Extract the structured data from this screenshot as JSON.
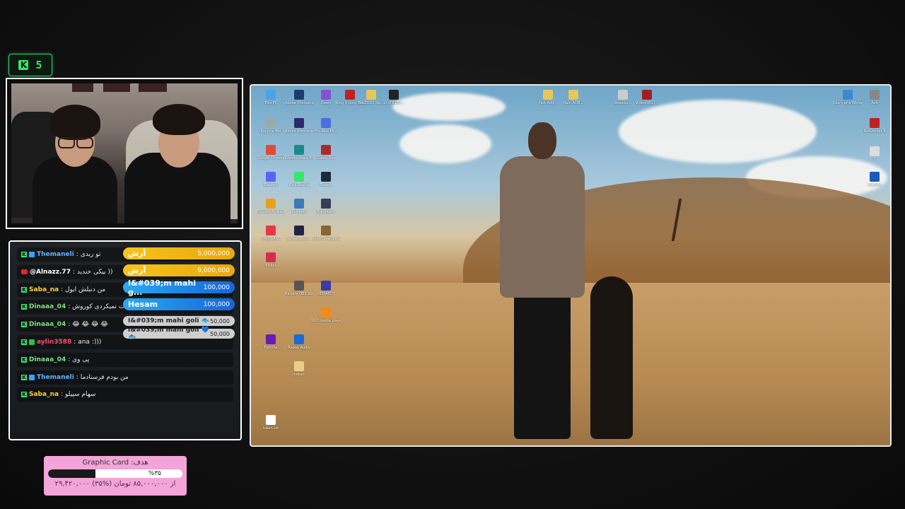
{
  "viewers": {
    "platform_icon": "K",
    "count": "5"
  },
  "chat": [
    {
      "platform": "kick",
      "badge": "blue",
      "user": "Themaneli",
      "user_color": "#5fb6ff",
      "message": ": تو ریدی"
    },
    {
      "platform": "youtube",
      "badge": "",
      "user": "@Alnazz.77",
      "user_color": "#ffffff",
      "message": ": بیکی خندید ))"
    },
    {
      "platform": "kick",
      "badge": "",
      "user": "Saba_na",
      "user_color": "#ffd23f",
      "message": ": من دنبلش ایول"
    },
    {
      "platform": "kick",
      "badge": "",
      "user": "Dinaaa_04",
      "user_color": "#7fe07f",
      "message": ": یا خودت نمیکردی کوروش"
    },
    {
      "platform": "kick",
      "badge": "",
      "user": "Dinaaa_04",
      "user_color": "#7fe07f",
      "message": ": 😂 😂 😂 😂"
    },
    {
      "platform": "kick",
      "badge": "green",
      "user": "aylin3588",
      "user_color": "#ff4d6d",
      "message": ": ana :)))"
    },
    {
      "platform": "kick",
      "badge": "",
      "user": "Dinaaa_04",
      "user_color": "#7fe07f",
      "message": ": پی وی"
    },
    {
      "platform": "kick",
      "badge": "blue",
      "user": "Themaneli",
      "user_color": "#5fb6ff",
      "message": ": من بودم فرستادما"
    },
    {
      "platform": "kick",
      "badge": "",
      "user": "Saba_na",
      "user_color": "#ffd23f",
      "message": ": سهام سپیلو"
    }
  ],
  "donations": [
    {
      "name": "آرش",
      "amount": "5,000,000",
      "style": "gold"
    },
    {
      "name": "آرش",
      "amount": "9,000,000",
      "style": "gold"
    },
    {
      "name": "I&#039;m mahi g...",
      "amount": "100,000",
      "style": "blue"
    },
    {
      "name": "Hesam",
      "amount": "100,000",
      "style": "blue"
    },
    {
      "name": "I&#039;m mahi goli 🐟",
      "amount": "50,000",
      "style": "gray"
    },
    {
      "name": "I&#039;m mahi goli 💙🐟",
      "amount": "50,000",
      "style": "gray"
    }
  ],
  "goal": {
    "title": "Graphic Card :هدف",
    "percent_label": "%۳۵",
    "progress": 0.35,
    "amount": "۲۹,۴۲۰,۰۰۰ از ۸۵,۰۰۰,۰۰۰ تومان (%۳۵)"
  },
  "desktop_icons": [
    {
      "label": "This PC",
      "color": "#4aa3e8"
    },
    {
      "label": "Adobe Photosho...",
      "color": "#1c3c6e"
    },
    {
      "label": "Dawn",
      "color": "#8a4fd0"
    },
    {
      "label": "King 9 Gold Events",
      "color": "#c02020"
    },
    {
      "label": "MAZOO3 No...",
      "color": "#e6c75a"
    },
    {
      "label": "1f 1FE2E8...",
      "color": "#222"
    },
    {
      "label": "Recycle Bin",
      "color": "#9aa"
    },
    {
      "label": "Adobe Premiere Pro",
      "color": "#2a2a6a"
    },
    {
      "label": "Pro Max Plus",
      "color": "#4b6fe0"
    },
    {
      "label": "Google Chrome",
      "color": "#e24a3a"
    },
    {
      "label": "Wondershare Filmora 14",
      "color": "#1a8a8a"
    },
    {
      "label": "Game Bar",
      "color": "#aa2a2a"
    },
    {
      "label": "Discord",
      "color": "#5865f2"
    },
    {
      "label": "Kick Studio",
      "color": "#39e46f"
    },
    {
      "label": "Steam",
      "color": "#1b2838"
    },
    {
      "label": "VALORANT",
      "color": "#e63946"
    },
    {
      "label": "StreamShot...",
      "color": "#222244"
    },
    {
      "label": "Road Crew Simulator",
      "color": "#886633"
    },
    {
      "label": "Kicker",
      "color": "#d82d4a"
    },
    {
      "label": "Counter-Strike 2",
      "color": "#e8a21a"
    },
    {
      "label": "Portfolio",
      "color": "#3a7ab8"
    },
    {
      "label": "Bandicam",
      "color": "#3a3a5a"
    },
    {
      "label": "Battery OBS Streaming",
      "color": "#555"
    },
    {
      "label": "REMATCH",
      "color": "#3a3aa8"
    },
    {
      "label": "VLC media player",
      "color": "#f08c1a"
    },
    {
      "label": "Rapoo Audio",
      "color": "#1a6ad8"
    },
    {
      "label": "Fortnite",
      "color": "#6a1ab8"
    },
    {
      "label": "metam",
      "color": "#e8d08a"
    },
    {
      "label": "token.txt",
      "color": "#ffffff"
    },
    {
      "label": "Fast Add...",
      "color": "#e8c75a"
    },
    {
      "label": "Rain ADB...",
      "color": "#e8c75a"
    },
    {
      "label": "dxwebs...",
      "color": "#ccc"
    },
    {
      "label": "Video(002)...",
      "color": "#a02020"
    },
    {
      "label": "Diary of a Wimpy Kid",
      "color": "#3a8ad0"
    },
    {
      "label": "Aeb",
      "color": "#888"
    },
    {
      "label": "NetLimiter 5",
      "color": "#c02020"
    },
    {
      "label": "2",
      "color": "#ddd"
    },
    {
      "label": "resume",
      "color": "#1a5ab8"
    }
  ]
}
